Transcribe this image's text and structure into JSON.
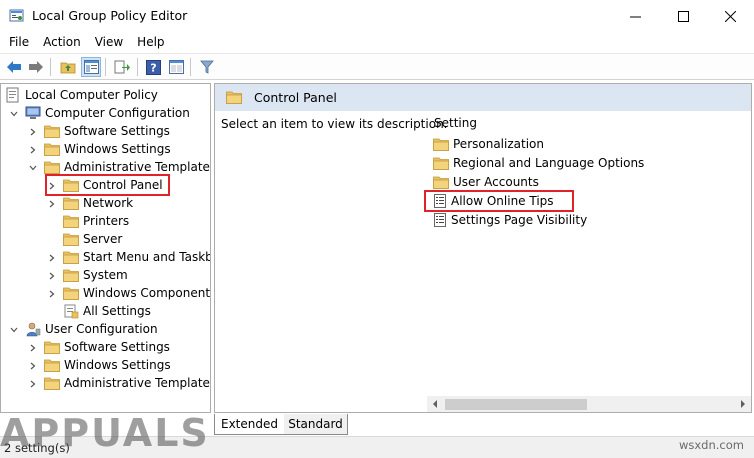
{
  "window": {
    "title": "Local Group Policy Editor",
    "minimize_icon": "minimize-icon",
    "maximize_icon": "maximize-icon",
    "close_icon": "close-icon"
  },
  "menu": [
    "File",
    "Action",
    "View",
    "Help"
  ],
  "toolbar": {
    "buttons": [
      "back-arrow-icon",
      "forward-arrow-icon",
      "up-folder-icon",
      "show-hide-tree-icon",
      "export-list-icon",
      "help-icon",
      "properties-view-icon",
      "filter-icon"
    ]
  },
  "tree": {
    "root": "Local Computer Policy",
    "computer_config": "Computer Configuration",
    "cc_software": "Software Settings",
    "cc_windows": "Windows Settings",
    "cc_admin": "Administrative Templates",
    "control_panel": "Control Panel",
    "network": "Network",
    "printers": "Printers",
    "server": "Server",
    "start_menu": "Start Menu and Taskbar",
    "system": "System",
    "windows_components": "Windows Components",
    "all_settings": "All Settings",
    "user_config": "User Configuration",
    "uc_software": "Software Settings",
    "uc_windows": "Windows Settings",
    "uc_admin": "Administrative Templates"
  },
  "right_pane": {
    "header_title": "Control Panel",
    "description": "Select an item to view its description.",
    "column_header": "Setting",
    "items": [
      {
        "label": "Personalization",
        "icon": "folder-icon"
      },
      {
        "label": "Regional and Language Options",
        "icon": "folder-icon"
      },
      {
        "label": "User Accounts",
        "icon": "folder-icon"
      },
      {
        "label": "Allow Online Tips",
        "icon": "policy-setting-icon"
      },
      {
        "label": "Settings Page Visibility",
        "icon": "policy-setting-icon"
      }
    ]
  },
  "tabs": [
    "Extended",
    "Standard"
  ],
  "status": "2 setting(s)",
  "watermark": "APPUALS",
  "site_watermark": "wsxdn.com",
  "colors": {
    "highlight": "#e0232a",
    "pane_header": "#dce6f2",
    "folder": "#e8c160"
  }
}
